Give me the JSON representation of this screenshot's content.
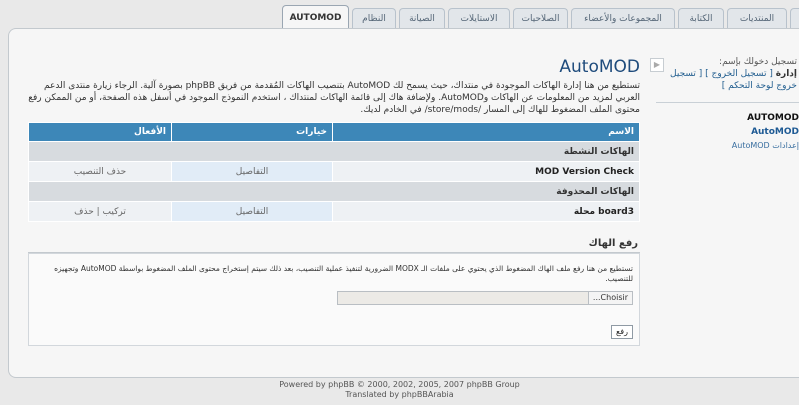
{
  "tabs": [
    {
      "label": "AUTOMOD",
      "active": true
    },
    {
      "label": "النظام",
      "active": false
    },
    {
      "label": "الصيانة",
      "active": false
    },
    {
      "label": "الاستايلات",
      "active": false
    },
    {
      "label": "الصلاحيات",
      "active": false
    },
    {
      "label": "المجموعات والأعضاء",
      "active": false
    },
    {
      "label": "الكتابة",
      "active": false
    },
    {
      "label": "المنتديات",
      "active": false
    }
  ],
  "sidebar": {
    "logged_in_as": "تسجيل دخولك بإسم:",
    "username": "إدارة",
    "logout_link": "[ تسجيل الخروج ]",
    "logout_acp_link": "[ تسجيل خروج لوحة التحكم ]",
    "section_title": "AUTOMOD",
    "item": "AutoMOD",
    "sub_item": "إعدادات AutoMOD"
  },
  "main": {
    "title": "AutoMOD",
    "intro": "تستطيع من هنا إدارة الهاكات الموجودة في منتداك، حيث يسمح لك AutoMOD بتنصيب الهاكات المُقدمة من فريق phpBB بصورة آلية. الرجاء زيارة منتدى الدعم العربي لمزيد من المعلومات عن الهاكات وAutoMOD. ولإضافة هاك إلى قائمة الهاكات لمنتداك ، استخدم النموذج الموجود في أسفل هذه الصفحة، أو من الممكن رفع محتوى الملف المضغوط للهاك إلى المسار /store/mods/ في الخادم لديك.",
    "table": {
      "headers": {
        "name": "الاسم",
        "options": "خيارات",
        "actions": "الأفعال"
      },
      "installed_section": "الهاكات النشطة",
      "installed_rows": [
        {
          "name": "MOD Version Check",
          "details": "التفاصيل",
          "actions": "حذف التنصيب"
        }
      ],
      "uninstalled_section": "الهاكات المحذوفة",
      "uninstalled_rows": [
        {
          "name": "board3 محلة",
          "details": "التفاصيل",
          "actions": "تركيب | حذف"
        }
      ]
    }
  },
  "upload": {
    "title": "رفع الهاك",
    "description": "تستطيع من هنا رفع ملف الهاك المضغوط الذي يحتوي على ملفات الـ MODX الضرورية لتنفيذ عملية التنصيب، بعد ذلك سيتم إستخراج محتوى الملف المضغوط بواسطة AutoMOD وتجهيزه للتنصيب.",
    "file_button": "Choisir...",
    "submit": "رفع"
  },
  "footer": {
    "line1": "Powered by phpBB © 2000, 2002, 2005, 2007 phpBB Group",
    "line2": "Translated by phpBBArabia"
  }
}
